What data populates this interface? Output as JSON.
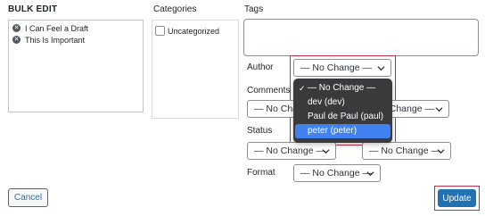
{
  "header": {
    "bulk_edit": "BULK EDIT",
    "categories": "Categories",
    "tags": "Tags"
  },
  "posts": [
    {
      "title": "I Can Feel a Draft"
    },
    {
      "title": "This Is Important"
    }
  ],
  "categories": [
    {
      "label": "Uncategorized",
      "checked": false
    }
  ],
  "fields": {
    "author_label": "Author",
    "author_value": "— No Change —",
    "comments_label": "Comments",
    "comments_value": "— No Change —",
    "pings_value": "— No Change —",
    "status_label": "Status",
    "status_value": "— No Change —",
    "sticky_value": "— No Change —",
    "format_label": "Format",
    "format_value": "— No Change —"
  },
  "author_dropdown": {
    "options": [
      {
        "label": "— No Change —",
        "checked": true
      },
      {
        "label": "dev (dev)",
        "checked": false
      },
      {
        "label": "Paul de Paul (paul)",
        "checked": false
      },
      {
        "label": "peter (peter)",
        "checked": false,
        "highlighted": true
      }
    ]
  },
  "buttons": {
    "cancel": "Cancel",
    "update": "Update"
  },
  "colors": {
    "accent": "#2271b1",
    "highlight_box": "#c62d48",
    "dropdown_bg": "#3a3a3c",
    "dropdown_active": "#3f82f0"
  }
}
